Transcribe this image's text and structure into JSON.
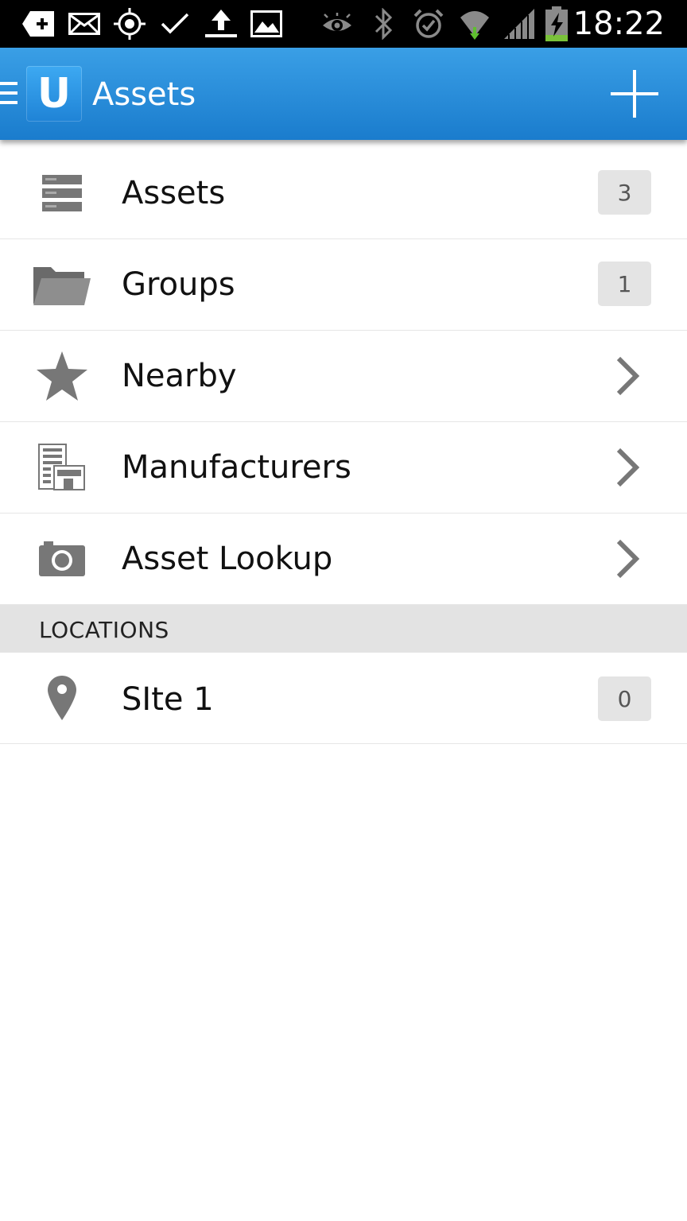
{
  "status_bar": {
    "time": "18:22",
    "icons": [
      "add-notification-icon",
      "mail-icon",
      "gps-icon",
      "check-icon",
      "upload-icon",
      "image-icon",
      "eye-icon",
      "bluetooth-icon",
      "alarm-icon",
      "wifi-icon",
      "signal-icon",
      "battery-charging-icon"
    ]
  },
  "action_bar": {
    "logo_letter": "U",
    "title": "Assets",
    "accent_color": "#2a8ee0"
  },
  "menu": {
    "items": [
      {
        "label": "Assets",
        "icon": "server-stack-icon",
        "count": "3"
      },
      {
        "label": "Groups",
        "icon": "folder-icon",
        "count": "1"
      },
      {
        "label": "Nearby",
        "icon": "star-icon"
      },
      {
        "label": "Manufacturers",
        "icon": "building-icon"
      },
      {
        "label": "Asset Lookup",
        "icon": "camera-icon"
      }
    ]
  },
  "locations": {
    "header": "LOCATIONS",
    "items": [
      {
        "label": "SIte 1",
        "icon": "map-pin-icon",
        "count": "0"
      }
    ]
  }
}
